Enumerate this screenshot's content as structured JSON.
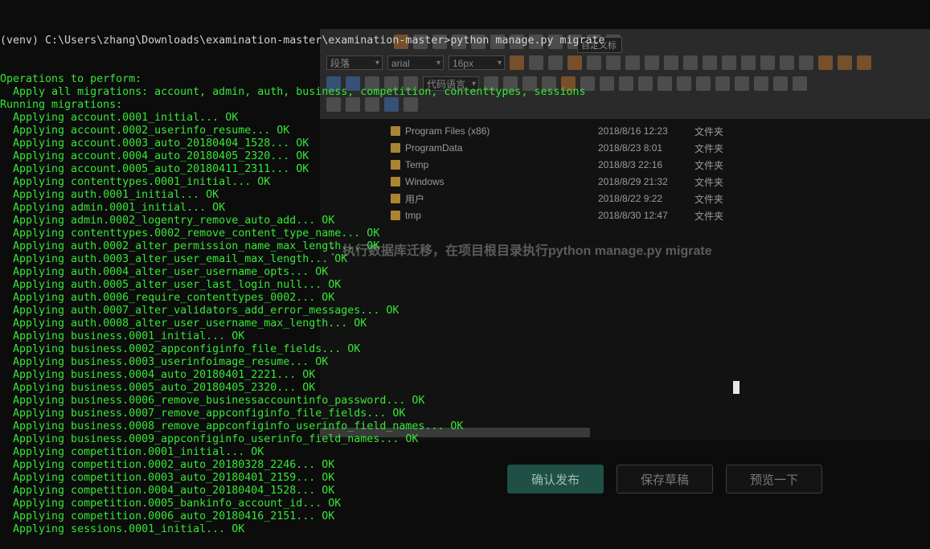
{
  "terminal": {
    "prompt": "(venv) C:\\Users\\zhang\\Downloads\\examination-master\\examination-master>python manage.py migrate",
    "lines": [
      "Operations to perform:",
      "  Apply all migrations: account, admin, auth, business, competition, contenttypes, sessions",
      "Running migrations:",
      "  Applying account.0001_initial... OK",
      "  Applying account.0002_userinfo_resume... OK",
      "  Applying account.0003_auto_20180404_1528... OK",
      "  Applying account.0004_auto_20180405_2320... OK",
      "  Applying account.0005_auto_20180411_2311... OK",
      "  Applying contenttypes.0001_initial... OK",
      "  Applying auth.0001_initial... OK",
      "  Applying admin.0001_initial... OK",
      "  Applying admin.0002_logentry_remove_auto_add... OK",
      "  Applying contenttypes.0002_remove_content_type_name... OK",
      "  Applying auth.0002_alter_permission_name_max_length... OK",
      "  Applying auth.0003_alter_user_email_max_length... OK",
      "  Applying auth.0004_alter_user_username_opts... OK",
      "  Applying auth.0005_alter_user_last_login_null... OK",
      "  Applying auth.0006_require_contenttypes_0002... OK",
      "  Applying auth.0007_alter_validators_add_error_messages... OK",
      "  Applying auth.0008_alter_user_username_max_length... OK",
      "  Applying business.0001_initial... OK",
      "  Applying business.0002_appconfiginfo_file_fields... OK",
      "  Applying business.0003_userinfoimage_resume... OK",
      "  Applying business.0004_auto_20180401_2221... OK",
      "  Applying business.0005_auto_20180405_2320... OK",
      "  Applying business.0006_remove_businessaccountinfo_password... OK",
      "  Applying business.0007_remove_appconfiginfo_file_fields... OK",
      "  Applying business.0008_remove_appconfiginfo_userinfo_field_names... OK",
      "  Applying business.0009_appconfiginfo_userinfo_field_names... OK",
      "  Applying competition.0001_initial... OK",
      "  Applying competition.0002_auto_20180328_2246... OK",
      "  Applying competition.0003_auto_20180401_2159... OK",
      "  Applying competition.0004_auto_20180404_1528... OK",
      "  Applying competition.0005_bankinfo_account_id... OK",
      "  Applying competition.0006_auto_20180416_2151... OK",
      "  Applying sessions.0001_initial... OK"
    ]
  },
  "editor": {
    "toolbar": {
      "paragraph_select": "段落",
      "font_select": "arial",
      "size_select": "16px",
      "code_lang_select": "代码语言",
      "custom_select": "自定义标"
    },
    "files": [
      {
        "name": "Program Files (x86)",
        "date": "2018/8/16 12:23",
        "type": "文件夹"
      },
      {
        "name": "ProgramData",
        "date": "2018/8/23 8:01",
        "type": "文件夹"
      },
      {
        "name": "Temp",
        "date": "2018/8/3 22:16",
        "type": "文件夹"
      },
      {
        "name": "Windows",
        "date": "2018/8/29 21:32",
        "type": "文件夹"
      },
      {
        "name": "用户",
        "date": "2018/8/22 9:22",
        "type": "文件夹"
      },
      {
        "name": "tmp",
        "date": "2018/8/30 12:47",
        "type": "文件夹"
      }
    ],
    "note": "：执行数据库迁移，在项目根目录执行python manage.py migrate",
    "buttons": {
      "publish": "确认发布",
      "save_draft": "保存草稿",
      "preview": "预览一下"
    }
  },
  "colors": {
    "terminal_bg": "#0c0c0c",
    "terminal_text": "#35e835",
    "prompt_text": "#d2d2d2",
    "publish_button": "#1f4f45"
  }
}
